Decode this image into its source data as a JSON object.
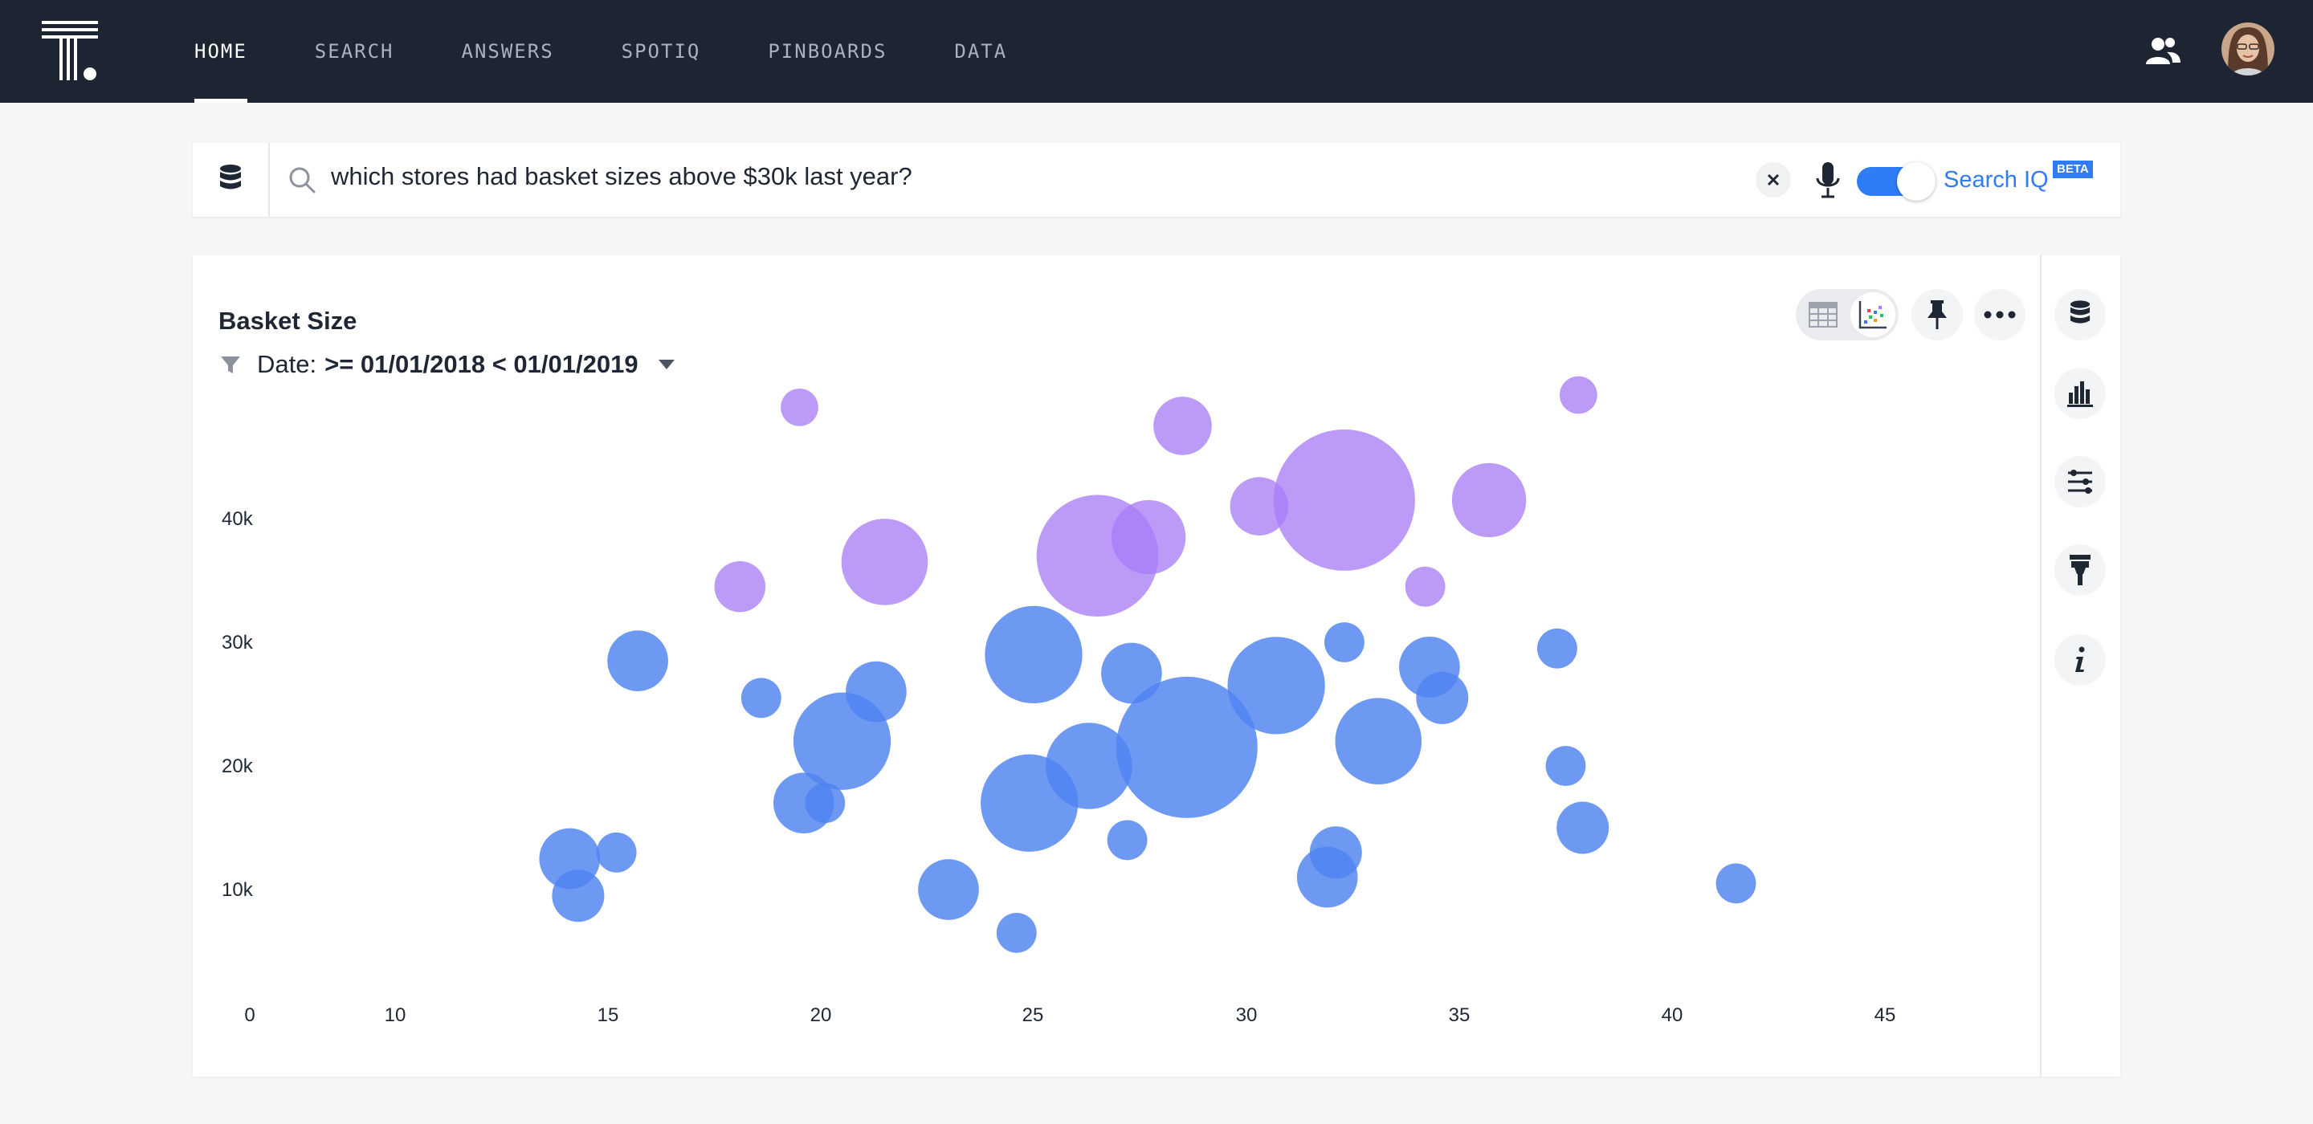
{
  "nav": {
    "items": [
      {
        "label": "HOME",
        "active": true
      },
      {
        "label": "SEARCH",
        "active": false
      },
      {
        "label": "ANSWERS",
        "active": false
      },
      {
        "label": "SPOTIQ",
        "active": false
      },
      {
        "label": "PINBOARDS",
        "active": false
      },
      {
        "label": "DATA",
        "active": false
      }
    ]
  },
  "search": {
    "query": "which stores had basket sizes above $30k last year?",
    "searchiq_label": "Search IQ",
    "beta_badge": "BETA",
    "searchiq_enabled": true
  },
  "card": {
    "title": "Basket Size",
    "filter_key": "Date:",
    "filter_value": ">= 01/01/2018 < 01/01/2019"
  },
  "colors": {
    "topbar": "#1c2531",
    "accent": "#2f7cf6",
    "series_low": "#4e82f0",
    "series_high": "#a97ef6"
  },
  "icons": [
    "logo",
    "people-icon",
    "avatar",
    "database-icon",
    "search-icon",
    "close-icon",
    "microphone-icon",
    "table-icon",
    "chart-icon",
    "pin-icon",
    "more-icon",
    "bar-chart-icon",
    "sliders-icon",
    "brush-icon",
    "info-icon",
    "filter-icon",
    "chevron-down-icon"
  ],
  "chart_data": {
    "type": "scatter",
    "title": "Basket Size",
    "xlabel": "",
    "ylabel": "",
    "x_ticks": [
      "0",
      "10",
      "15",
      "20",
      "25",
      "30",
      "35",
      "40",
      "45"
    ],
    "y_ticks": [
      "10k",
      "20k",
      "30k",
      "40k"
    ],
    "bubble": true,
    "points": [
      {
        "x": 19.5,
        "y": 49000,
        "size": 0.15,
        "group": "high"
      },
      {
        "x": 28.5,
        "y": 47500,
        "size": 0.32,
        "group": "high"
      },
      {
        "x": 37.8,
        "y": 50000,
        "size": 0.15,
        "group": "high"
      },
      {
        "x": 32.3,
        "y": 41500,
        "size": 1.0,
        "group": "high"
      },
      {
        "x": 35.7,
        "y": 41500,
        "size": 0.45,
        "group": "high"
      },
      {
        "x": 30.3,
        "y": 41000,
        "size": 0.32,
        "group": "high"
      },
      {
        "x": 27.7,
        "y": 38500,
        "size": 0.45,
        "group": "high"
      },
      {
        "x": 26.5,
        "y": 37000,
        "size": 0.84,
        "group": "high"
      },
      {
        "x": 21.5,
        "y": 36500,
        "size": 0.55,
        "group": "high"
      },
      {
        "x": 18.1,
        "y": 34500,
        "size": 0.26,
        "group": "high"
      },
      {
        "x": 34.2,
        "y": 34500,
        "size": 0.17,
        "group": "high"
      },
      {
        "x": 15.7,
        "y": 28500,
        "size": 0.34,
        "group": "low"
      },
      {
        "x": 25.0,
        "y": 29000,
        "size": 0.64,
        "group": "low"
      },
      {
        "x": 27.3,
        "y": 27500,
        "size": 0.34,
        "group": "low"
      },
      {
        "x": 30.7,
        "y": 26500,
        "size": 0.64,
        "group": "low"
      },
      {
        "x": 32.3,
        "y": 30000,
        "size": 0.17,
        "group": "low"
      },
      {
        "x": 34.3,
        "y": 28000,
        "size": 0.34,
        "group": "low"
      },
      {
        "x": 34.6,
        "y": 25500,
        "size": 0.27,
        "group": "low"
      },
      {
        "x": 37.3,
        "y": 29500,
        "size": 0.17,
        "group": "low"
      },
      {
        "x": 18.6,
        "y": 25500,
        "size": 0.17,
        "group": "low"
      },
      {
        "x": 21.3,
        "y": 26000,
        "size": 0.34,
        "group": "low"
      },
      {
        "x": 20.5,
        "y": 22000,
        "size": 0.64,
        "group": "low"
      },
      {
        "x": 19.6,
        "y": 17000,
        "size": 0.34,
        "group": "low"
      },
      {
        "x": 20.1,
        "y": 17000,
        "size": 0.17,
        "group": "low"
      },
      {
        "x": 24.9,
        "y": 17000,
        "size": 0.64,
        "group": "low"
      },
      {
        "x": 26.3,
        "y": 20000,
        "size": 0.55,
        "group": "low"
      },
      {
        "x": 28.6,
        "y": 21500,
        "size": 1.0,
        "group": "low"
      },
      {
        "x": 33.1,
        "y": 22000,
        "size": 0.55,
        "group": "low"
      },
      {
        "x": 37.5,
        "y": 20000,
        "size": 0.17,
        "group": "low"
      },
      {
        "x": 37.9,
        "y": 15000,
        "size": 0.27,
        "group": "low"
      },
      {
        "x": 14.1,
        "y": 12500,
        "size": 0.34,
        "group": "low"
      },
      {
        "x": 15.2,
        "y": 13000,
        "size": 0.17,
        "group": "low"
      },
      {
        "x": 14.3,
        "y": 9500,
        "size": 0.27,
        "group": "low"
      },
      {
        "x": 27.2,
        "y": 14000,
        "size": 0.17,
        "group": "low"
      },
      {
        "x": 32.1,
        "y": 13000,
        "size": 0.27,
        "group": "low"
      },
      {
        "x": 31.9,
        "y": 11000,
        "size": 0.34,
        "group": "low"
      },
      {
        "x": 23.0,
        "y": 10000,
        "size": 0.34,
        "group": "low"
      },
      {
        "x": 24.6,
        "y": 6500,
        "size": 0.17,
        "group": "low"
      },
      {
        "x": 41.5,
        "y": 10500,
        "size": 0.17,
        "group": "low"
      }
    ]
  }
}
